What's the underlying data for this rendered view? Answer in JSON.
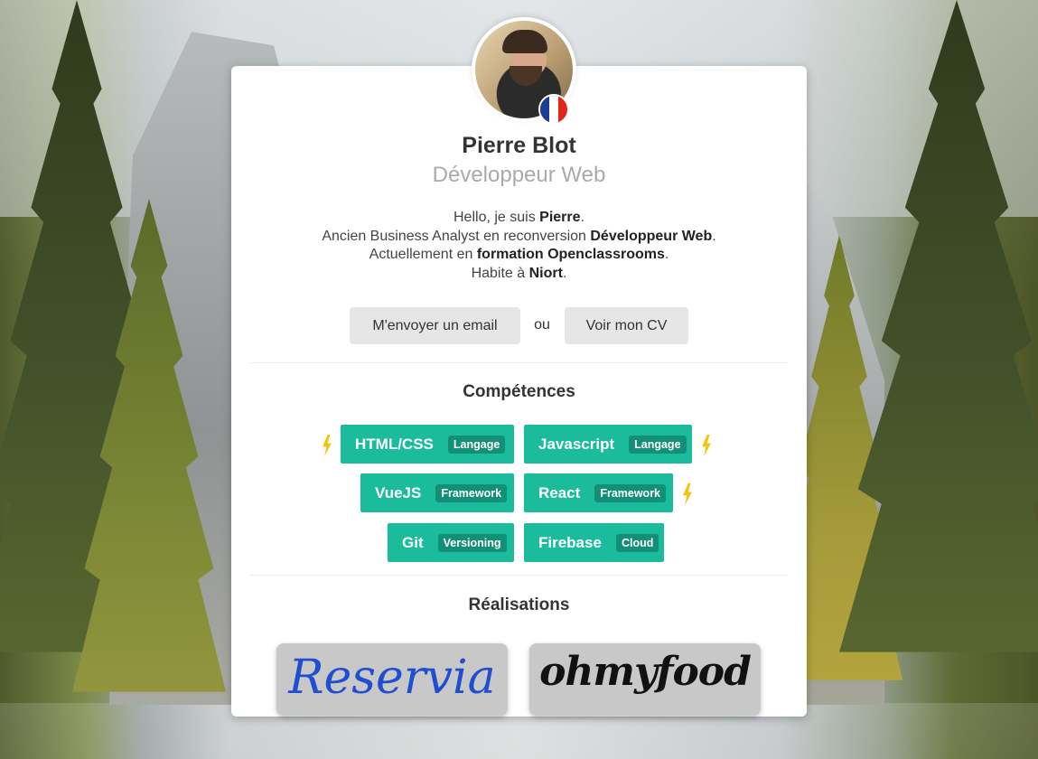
{
  "profile": {
    "name": "Pierre Blot",
    "role": "Développeur Web",
    "bio": {
      "line1_pre": "Hello, je suis ",
      "line1_bold": "Pierre",
      "line1_post": ".",
      "line2_pre": "Ancien Business Analyst en reconversion ",
      "line2_bold": "Développeur Web",
      "line2_post": ".",
      "line3_pre": "Actuellement en ",
      "line3_bold": "formation Openclassrooms",
      "line3_post": ".",
      "line4_pre": "Habite à ",
      "line4_bold": "Niort",
      "line4_post": "."
    }
  },
  "actions": {
    "email_label": "M'envoyer un email",
    "or_label": "ou",
    "cv_label": "Voir mon CV"
  },
  "skills": {
    "title": "Compétences",
    "items": [
      {
        "name": "HTML/CSS",
        "tag": "Langage",
        "favorite": true
      },
      {
        "name": "Javascript",
        "tag": "Langage",
        "favorite": true
      },
      {
        "name": "VueJS",
        "tag": "Framework",
        "favorite": false
      },
      {
        "name": "React",
        "tag": "Framework",
        "favorite": true
      },
      {
        "name": "Git",
        "tag": "Versioning",
        "favorite": false
      },
      {
        "name": "Firebase",
        "tag": "Cloud",
        "favorite": false
      }
    ]
  },
  "projects": {
    "title": "Réalisations",
    "items": [
      {
        "logo_text": "Reservia"
      },
      {
        "logo_text": "ohmyfood"
      }
    ]
  },
  "colors": {
    "accent": "#1abc9c",
    "tag_bg": "#148f77",
    "bolt": "#f1c40f",
    "button_bg": "#e6e6e6",
    "flag": [
      "#1c3f94",
      "#ffffff",
      "#e1251b"
    ]
  },
  "icons": {
    "favorite": "lightning-bolt-icon",
    "flag": "france-flag-icon"
  }
}
